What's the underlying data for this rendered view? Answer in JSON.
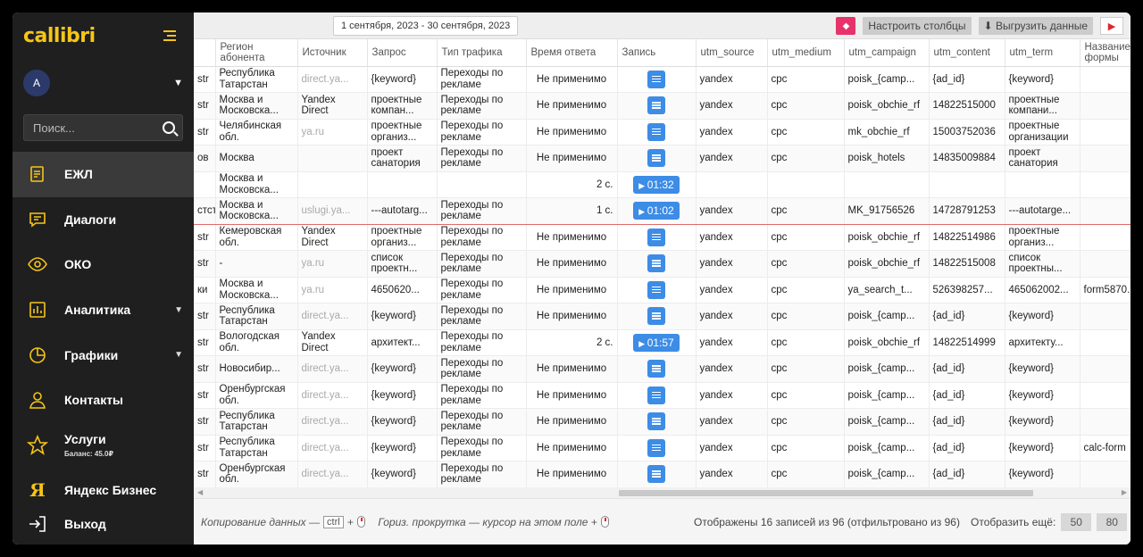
{
  "sidebar": {
    "logo": "callibri",
    "user_initial": "A",
    "search_placeholder": "Поиск...",
    "items": [
      {
        "label": "ЕЖЛ",
        "icon": "journal-icon"
      },
      {
        "label": "Диалоги",
        "icon": "chat-icon"
      },
      {
        "label": "ОКО",
        "icon": "eye-icon"
      },
      {
        "label": "Аналитика",
        "icon": "analytics-icon"
      },
      {
        "label": "Графики",
        "icon": "pie-chart-icon"
      },
      {
        "label": "Контакты",
        "icon": "user-icon"
      },
      {
        "label": "Услуги",
        "sub": "Баланс: 45.0₽",
        "icon": "star-icon"
      },
      {
        "label": "Яндекс Бизнес",
        "icon": "yandex-icon",
        "glyph": "Я"
      },
      {
        "label": "Выход",
        "icon": "logout-icon"
      }
    ]
  },
  "toolbar": {
    "date_range": "1 сентября, 2023 - 30 сентября, 2023",
    "columns_btn": "Настроить столбцы",
    "export_btn": "Выгрузить данные"
  },
  "table": {
    "headers": [
      "",
      "Регион абонента",
      "Источник",
      "Запрос",
      "Тип трафика",
      "Время ответа",
      "Запись",
      "utm_source",
      "utm_medium",
      "utm_campaign",
      "utm_content",
      "utm_term",
      "Название формы"
    ],
    "rows": [
      [
        "str",
        "Республика Татарстан",
        "direct.ya...",
        "{keyword}",
        "Переходы по рекламе",
        "Не применимо",
        "icon",
        "yandex",
        "cpc",
        "poisk_{camp...",
        "{ad_id}",
        "{keyword}",
        ""
      ],
      [
        "str",
        "Москва и Московска...",
        "Yandex Direct",
        "проектные компан...",
        "Переходы по рекламе",
        "Не применимо",
        "icon",
        "yandex",
        "cpc",
        "poisk_obchie_rf",
        "14822515000",
        "проектные компани...",
        ""
      ],
      [
        "str",
        "Челябинская обл.",
        "ya.ru",
        "проектные организ...",
        "Переходы по рекламе",
        "Не применимо",
        "icon",
        "yandex",
        "cpc",
        "mk_obchie_rf",
        "15003752036",
        "проектные организации",
        ""
      ],
      [
        "ов",
        "Москва",
        "",
        "проект санатория",
        "Переходы по рекламе",
        "Не применимо",
        "icon",
        "yandex",
        "cpc",
        "poisk_hotels",
        "14835009884",
        "проект санатория",
        ""
      ],
      [
        "",
        "Москва и Московска...",
        "",
        "",
        "",
        "2 с.",
        "01:32",
        "",
        "",
        "",
        "",
        "",
        ""
      ],
      [
        "стст",
        "Москва и Московска...",
        "uslugi.ya...",
        "---autotarg...",
        "Переходы по рекламе",
        "1 с.",
        "01:02",
        "yandex",
        "cpc",
        "MK_91756526",
        "14728791253",
        "---autotarge...",
        ""
      ],
      [
        "str",
        "Кемеровская обл.",
        "Yandex Direct",
        "проектные организ...",
        "Переходы по рекламе",
        "Не применимо",
        "icon",
        "yandex",
        "cpc",
        "poisk_obchie_rf",
        "14822514986",
        "проектные организ...",
        ""
      ],
      [
        "str",
        "-",
        "ya.ru",
        "список проектн...",
        "Переходы по рекламе",
        "Не применимо",
        "icon",
        "yandex",
        "cpc",
        "poisk_obchie_rf",
        "14822515008",
        "список проектны...",
        ""
      ],
      [
        "ки",
        "Москва и Московска...",
        "ya.ru",
        "4650620...",
        "Переходы по рекламе",
        "Не применимо",
        "icon",
        "yandex",
        "cpc",
        "ya_search_t...",
        "526398257...",
        "465062002...",
        "form5870..."
      ],
      [
        "str",
        "Республика Татарстан",
        "direct.ya...",
        "{keyword}",
        "Переходы по рекламе",
        "Не применимо",
        "icon",
        "yandex",
        "cpc",
        "poisk_{camp...",
        "{ad_id}",
        "{keyword}",
        ""
      ],
      [
        "str",
        "Вологодская обл.",
        "Yandex Direct",
        "архитект...",
        "Переходы по рекламе",
        "2 с.",
        "01:57",
        "yandex",
        "cpc",
        "poisk_obchie_rf",
        "14822514999",
        "архитекту...",
        ""
      ],
      [
        "str",
        "Новосибир...",
        "direct.ya...",
        "{keyword}",
        "Переходы по рекламе",
        "Не применимо",
        "icon",
        "yandex",
        "cpc",
        "poisk_{camp...",
        "{ad_id}",
        "{keyword}",
        ""
      ],
      [
        "str",
        "Оренбургская обл.",
        "direct.ya...",
        "{keyword}",
        "Переходы по рекламе",
        "Не применимо",
        "icon",
        "yandex",
        "cpc",
        "poisk_{camp...",
        "{ad_id}",
        "{keyword}",
        ""
      ],
      [
        "str",
        "Республика Татарстан",
        "direct.ya...",
        "{keyword}",
        "Переходы по рекламе",
        "Не применимо",
        "icon",
        "yandex",
        "cpc",
        "poisk_{camp...",
        "{ad_id}",
        "{keyword}",
        ""
      ],
      [
        "str",
        "Республика Татарстан",
        "direct.ya...",
        "{keyword}",
        "Переходы по рекламе",
        "Не применимо",
        "icon",
        "yandex",
        "cpc",
        "poisk_{camp...",
        "{ad_id}",
        "{keyword}",
        "calc-form"
      ],
      [
        "str",
        "Оренбургская обл.",
        "direct.ya...",
        "{keyword}",
        "Переходы по рекламе",
        "Не применимо",
        "icon",
        "yandex",
        "cpc",
        "poisk_{camp...",
        "{ad_id}",
        "{keyword}",
        ""
      ]
    ],
    "highlighted_row": 5
  },
  "footer": {
    "copy_hint": "Копирование данных —",
    "ctrl_key": "ctrl",
    "scroll_hint": "Гориз. прокрутка — курсор на этом поле +",
    "count_text": "Отображены 16 записей из 96 (отфильтровано из 96)",
    "show_more_label": "Отобразить ещё:",
    "more_options": [
      "50",
      "80"
    ]
  },
  "colors": {
    "accent": "#f5c518",
    "sidebar_bg": "#1f1f1f",
    "record_blue": "#3d8ce6",
    "highlight": "#e06a6a"
  }
}
